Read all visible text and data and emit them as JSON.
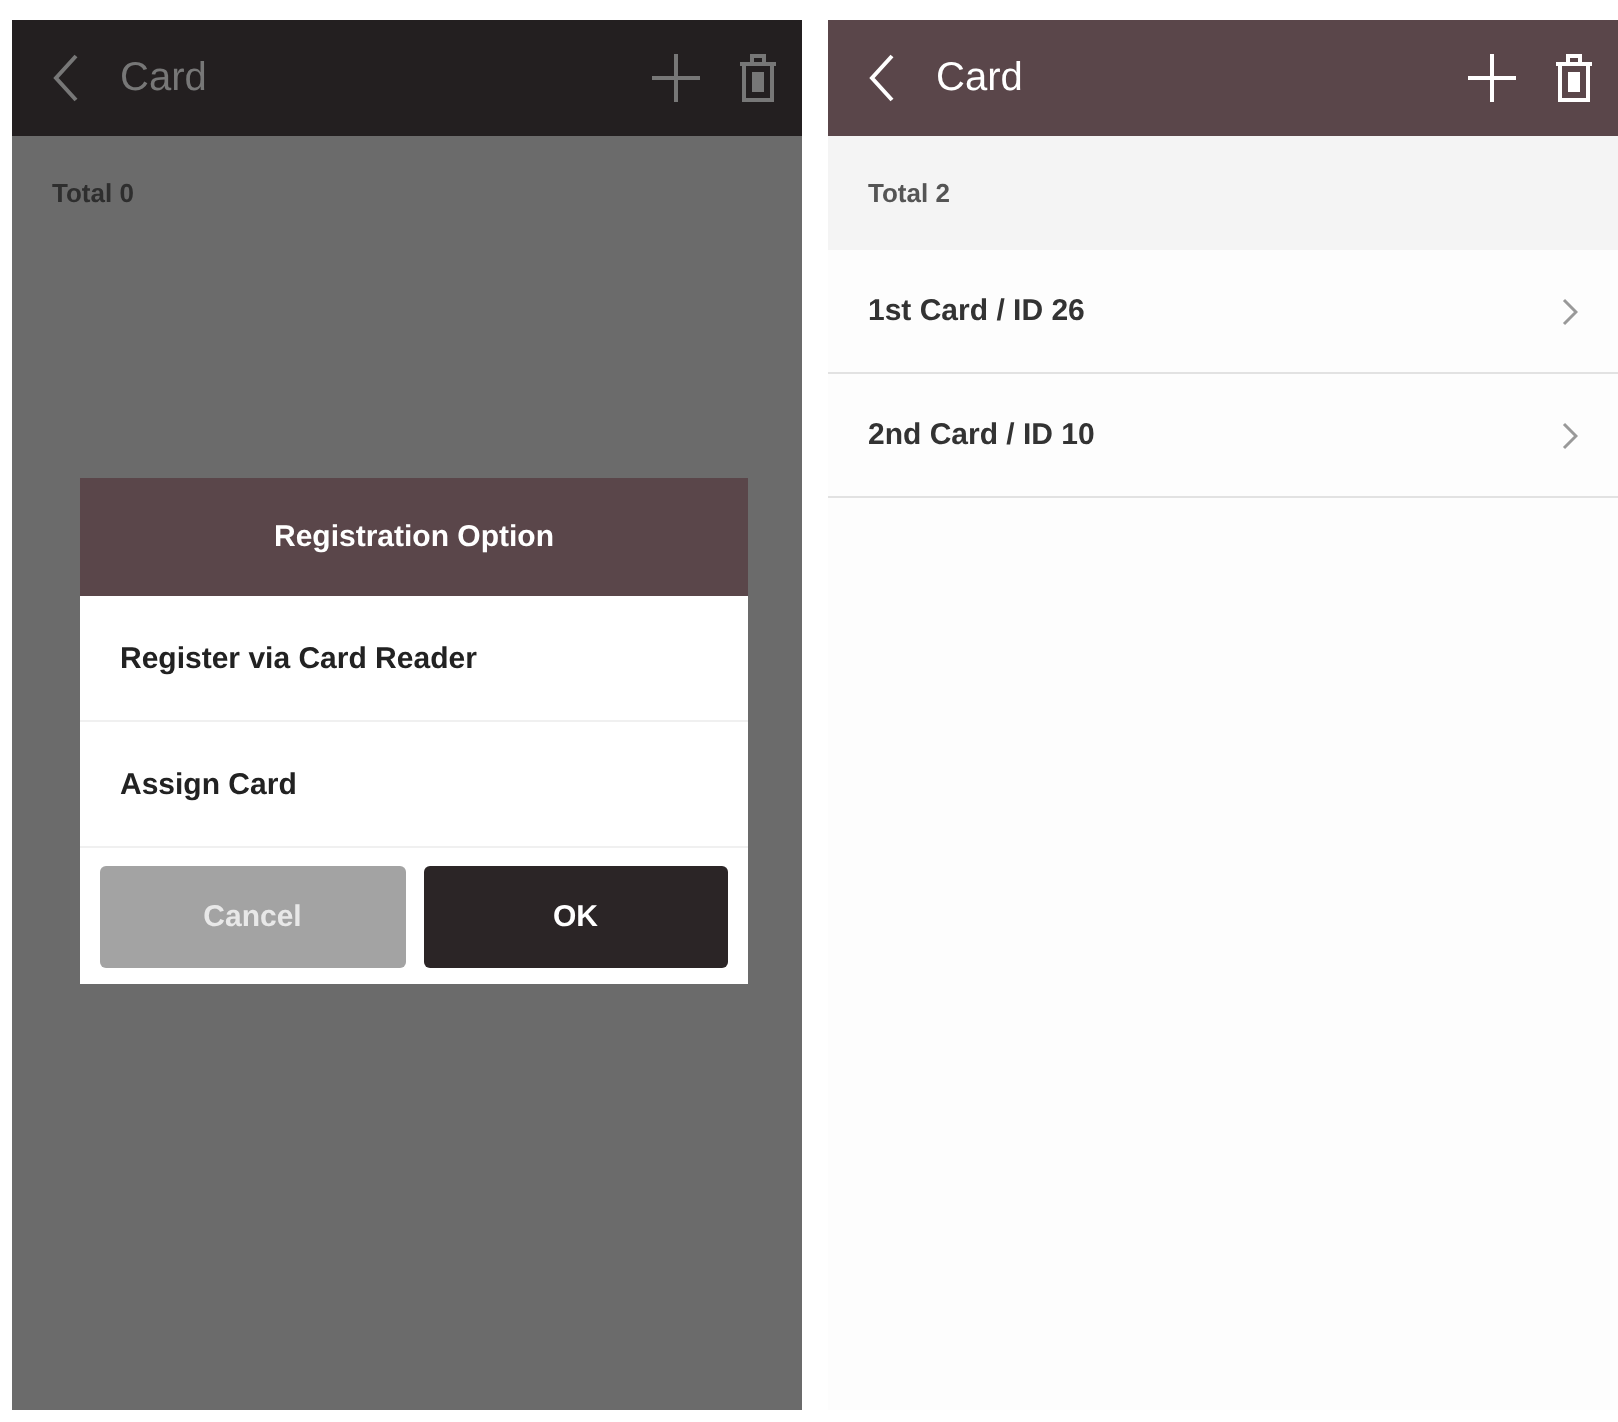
{
  "screens": [
    {
      "title": "Card",
      "dimmed": true,
      "total": "Total 0",
      "dialog": {
        "title": "Registration Option",
        "options": [
          "Register via Card Reader",
          "Assign Card"
        ],
        "buttons": [
          {
            "label": "Cancel",
            "kind": "cancel"
          },
          {
            "label": "OK",
            "kind": "ok"
          }
        ]
      }
    },
    {
      "title": "Card",
      "dimmed": false,
      "total": "Total 2",
      "items": [
        {
          "label": "1st Card / ID 26"
        },
        {
          "label": "2nd Card / ID 10"
        }
      ]
    }
  ]
}
